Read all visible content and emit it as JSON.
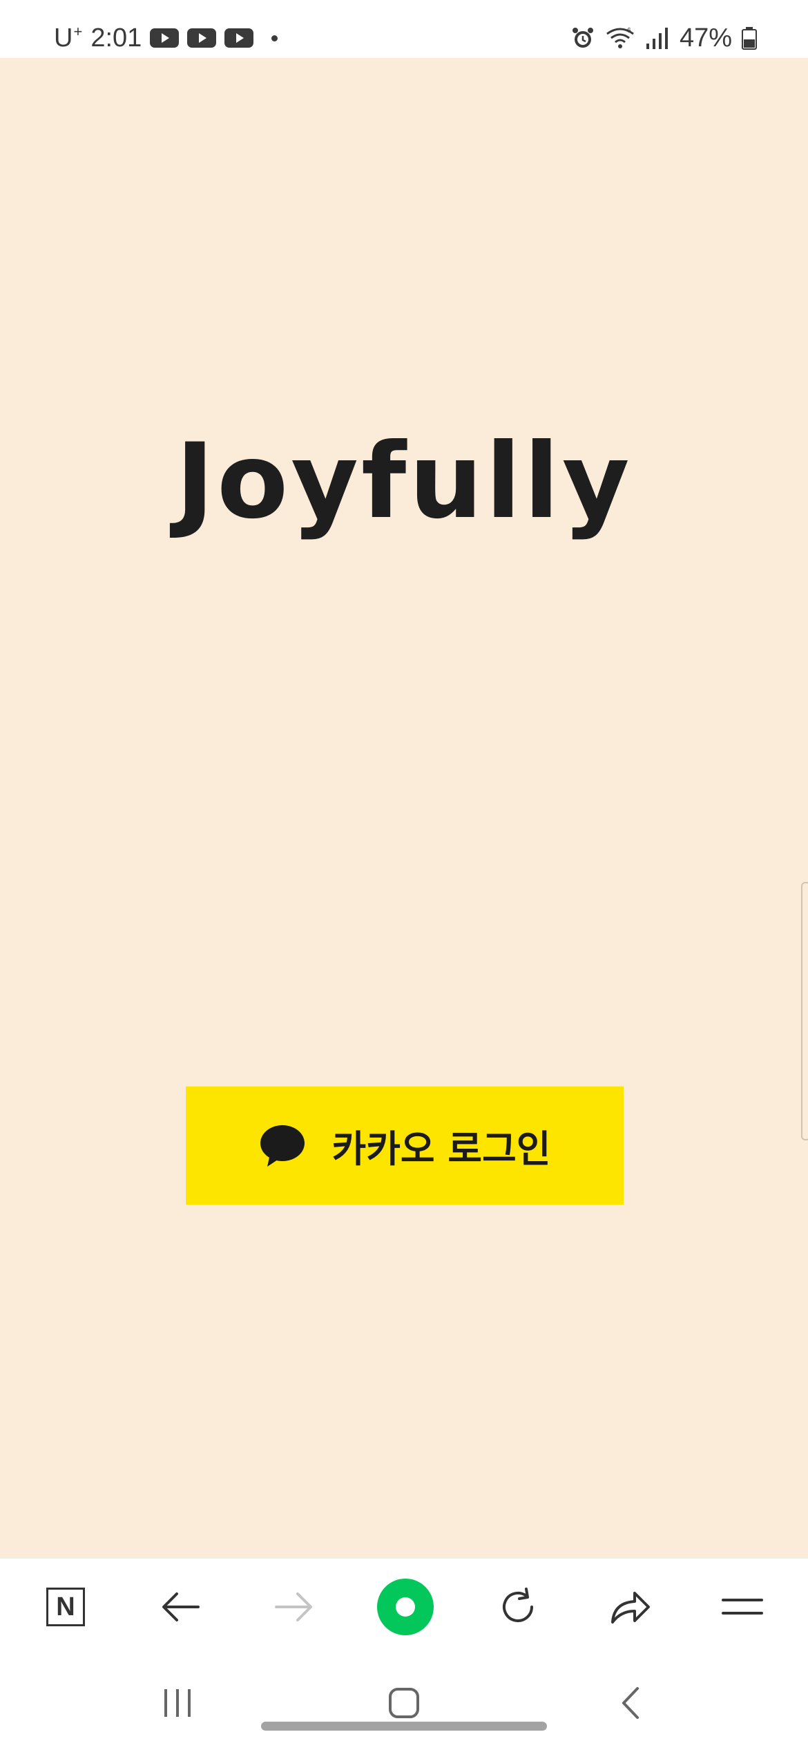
{
  "status_bar": {
    "carrier": "U",
    "carrier_sup": "+",
    "time": "2:01",
    "battery": "47%",
    "icons": [
      "youtube-icon",
      "youtube-icon",
      "youtube-icon",
      "dot-icon",
      "alarm-icon",
      "wifi-icon",
      "signal-icon",
      "battery-icon"
    ]
  },
  "main": {
    "title": "Joyfully",
    "kakao_login_label": "카카오 로그인",
    "kakao_color": "#FEE500",
    "background_color": "#FAECD9"
  },
  "browser_toolbar": {
    "naver_label": "N",
    "buttons": [
      "naver-home-icon",
      "back-arrow-icon",
      "forward-arrow-icon",
      "green-dot-icon",
      "refresh-icon",
      "share-icon",
      "menu-icon"
    ],
    "accent_color": "#03C75A"
  },
  "nav_bar": {
    "buttons": [
      "recent-apps-icon",
      "home-icon",
      "back-icon"
    ]
  }
}
